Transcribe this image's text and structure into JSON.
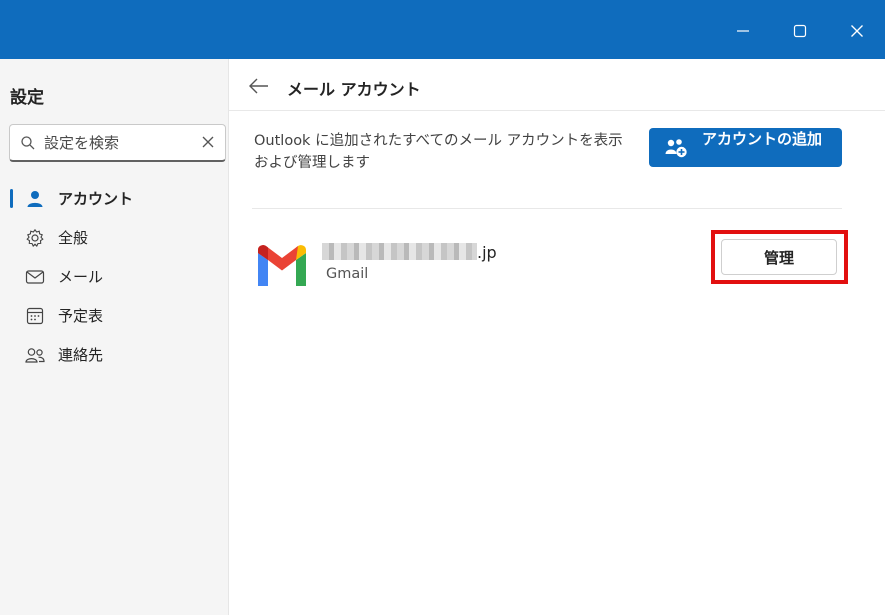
{
  "window": {
    "controls": [
      "minimize",
      "maximize",
      "close"
    ]
  },
  "sidebar": {
    "title": "設定",
    "search": {
      "placeholder": "設定を検索",
      "value": ""
    },
    "items": [
      {
        "label": "アカウント",
        "icon": "person-icon",
        "active": true
      },
      {
        "label": "全般",
        "icon": "gear-icon",
        "active": false
      },
      {
        "label": "メール",
        "icon": "mail-icon",
        "active": false
      },
      {
        "label": "予定表",
        "icon": "calendar-icon",
        "active": false
      },
      {
        "label": "連絡先",
        "icon": "people-icon",
        "active": false
      }
    ]
  },
  "main": {
    "title": "メール アカウント",
    "description": "Outlook に追加されたすべてのメール アカウントを表示および管理します",
    "add_account_label": "アカウントの追加",
    "account": {
      "email_suffix": ".jp",
      "provider": "Gmail",
      "manage_label": "管理"
    }
  },
  "colors": {
    "accent": "#0f6cbd",
    "highlight": "#e20f0f",
    "sidebar_bg": "#f5f5f5"
  }
}
